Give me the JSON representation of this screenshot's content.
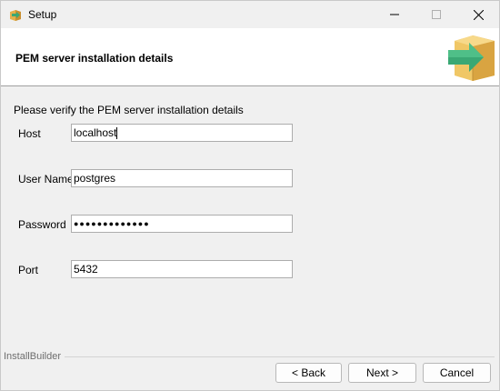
{
  "window": {
    "title": "Setup",
    "icons": {
      "app": "installer-box-icon",
      "minimize": "minimize-icon",
      "maximize": "maximize-icon",
      "close": "close-icon"
    }
  },
  "header": {
    "title": "PEM server installation details",
    "icon": "installer-box-arrow-icon",
    "accent_colors": {
      "box": "#e8b752",
      "arrow": "#3aa874"
    }
  },
  "form": {
    "intro": "Please verify the PEM server installation details",
    "fields": [
      {
        "label": "Host",
        "value": "localhost"
      },
      {
        "label": "User Name",
        "value": "postgres"
      },
      {
        "label": "Password",
        "value": "●●●●●●●●●●●●●"
      },
      {
        "label": "Port",
        "value": "5432"
      }
    ]
  },
  "footer": {
    "brand": "InstallBuilder",
    "buttons": {
      "back": "< Back",
      "next": "Next >",
      "cancel": "Cancel"
    }
  }
}
